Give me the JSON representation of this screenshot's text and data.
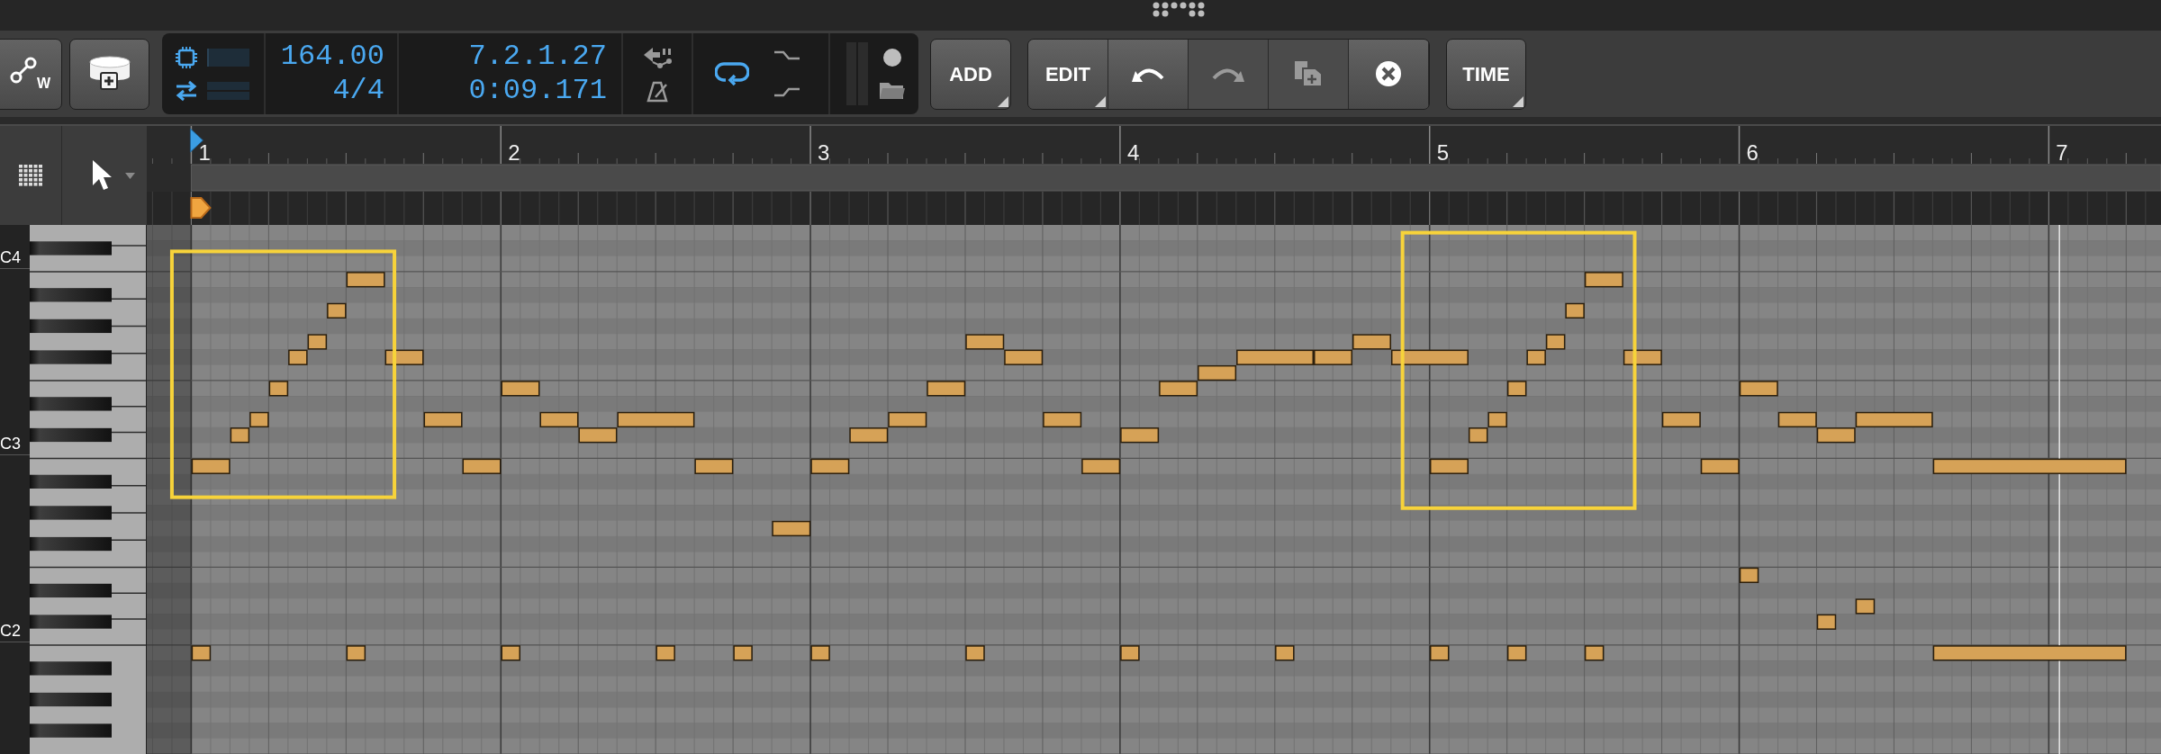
{
  "toolbar": {
    "panel_buttons": [
      {
        "kind": "graph",
        "letter": "W"
      },
      {
        "kind": "add-device"
      }
    ],
    "transport": {
      "tempo": "164.00",
      "time_signature": "4/4",
      "position_bars": "7.2.1.27",
      "position_time": "0:09.171",
      "loop_on": true
    },
    "add_button": {
      "label": "ADD",
      "has_menu": true
    },
    "edit_group": [
      {
        "kind": "text",
        "label": "EDIT",
        "has_menu": true,
        "disabled": false
      },
      {
        "kind": "undo",
        "disabled": false
      },
      {
        "kind": "redo",
        "disabled": true
      },
      {
        "kind": "duplicate",
        "disabled": true
      },
      {
        "kind": "delete",
        "disabled": false
      }
    ],
    "time_button": {
      "label": "TIME",
      "has_menu": true
    }
  },
  "piano_roll": {
    "ruler": {
      "bars": [
        "1",
        "2",
        "3",
        "4",
        "5",
        "6",
        "7"
      ]
    },
    "keyboard": {
      "labels": [
        {
          "text": "C4"
        },
        {
          "text": "C3"
        },
        {
          "text": "C2"
        }
      ]
    }
  }
}
